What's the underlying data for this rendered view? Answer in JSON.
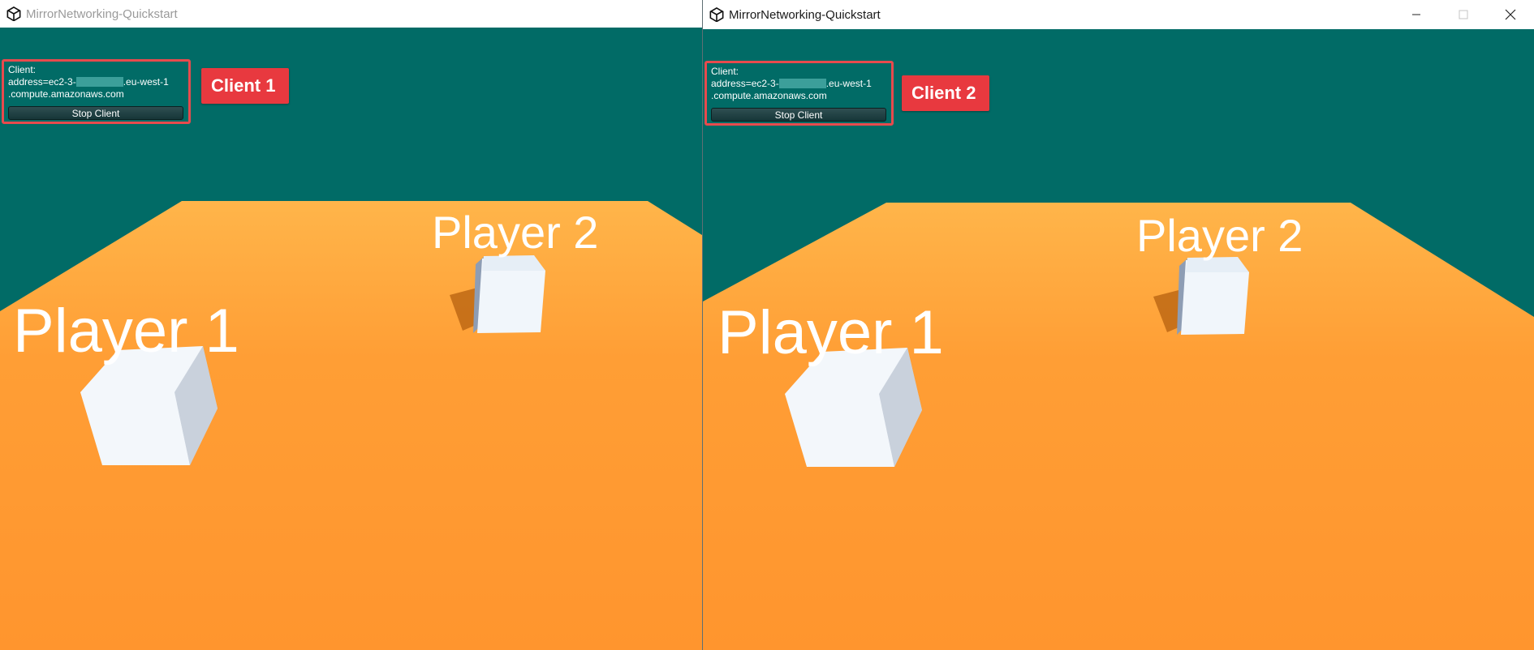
{
  "windows": [
    {
      "title": "MirrorNetworking-Quickstart",
      "hud": {
        "client_label": "Client:",
        "address_prefix": "address=ec2-3-",
        "address_suffix": ".eu-west-1",
        "address_line2": ".compute.amazonaws.com",
        "stop_button": "Stop Client"
      },
      "badge": "Client 1",
      "players": {
        "p1": "Player 1",
        "p2": "Player 2"
      }
    },
    {
      "title": "MirrorNetworking-Quickstart",
      "hud": {
        "client_label": "Client:",
        "address_prefix": "address=ec2-3-",
        "address_suffix": ".eu-west-1",
        "address_line2": ".compute.amazonaws.com",
        "stop_button": "Stop Client"
      },
      "badge": "Client 2",
      "players": {
        "p1": "Player 1",
        "p2": "Player 2"
      }
    }
  ],
  "icons": {
    "app": "unity-icon",
    "minimize": "minimize-icon",
    "maximize": "maximize-icon",
    "close": "close-icon"
  },
  "colors": {
    "sky": "#016B66",
    "floor": "#FF9A32",
    "badge": "#E8393F",
    "hud_border": "#E84A4D"
  }
}
